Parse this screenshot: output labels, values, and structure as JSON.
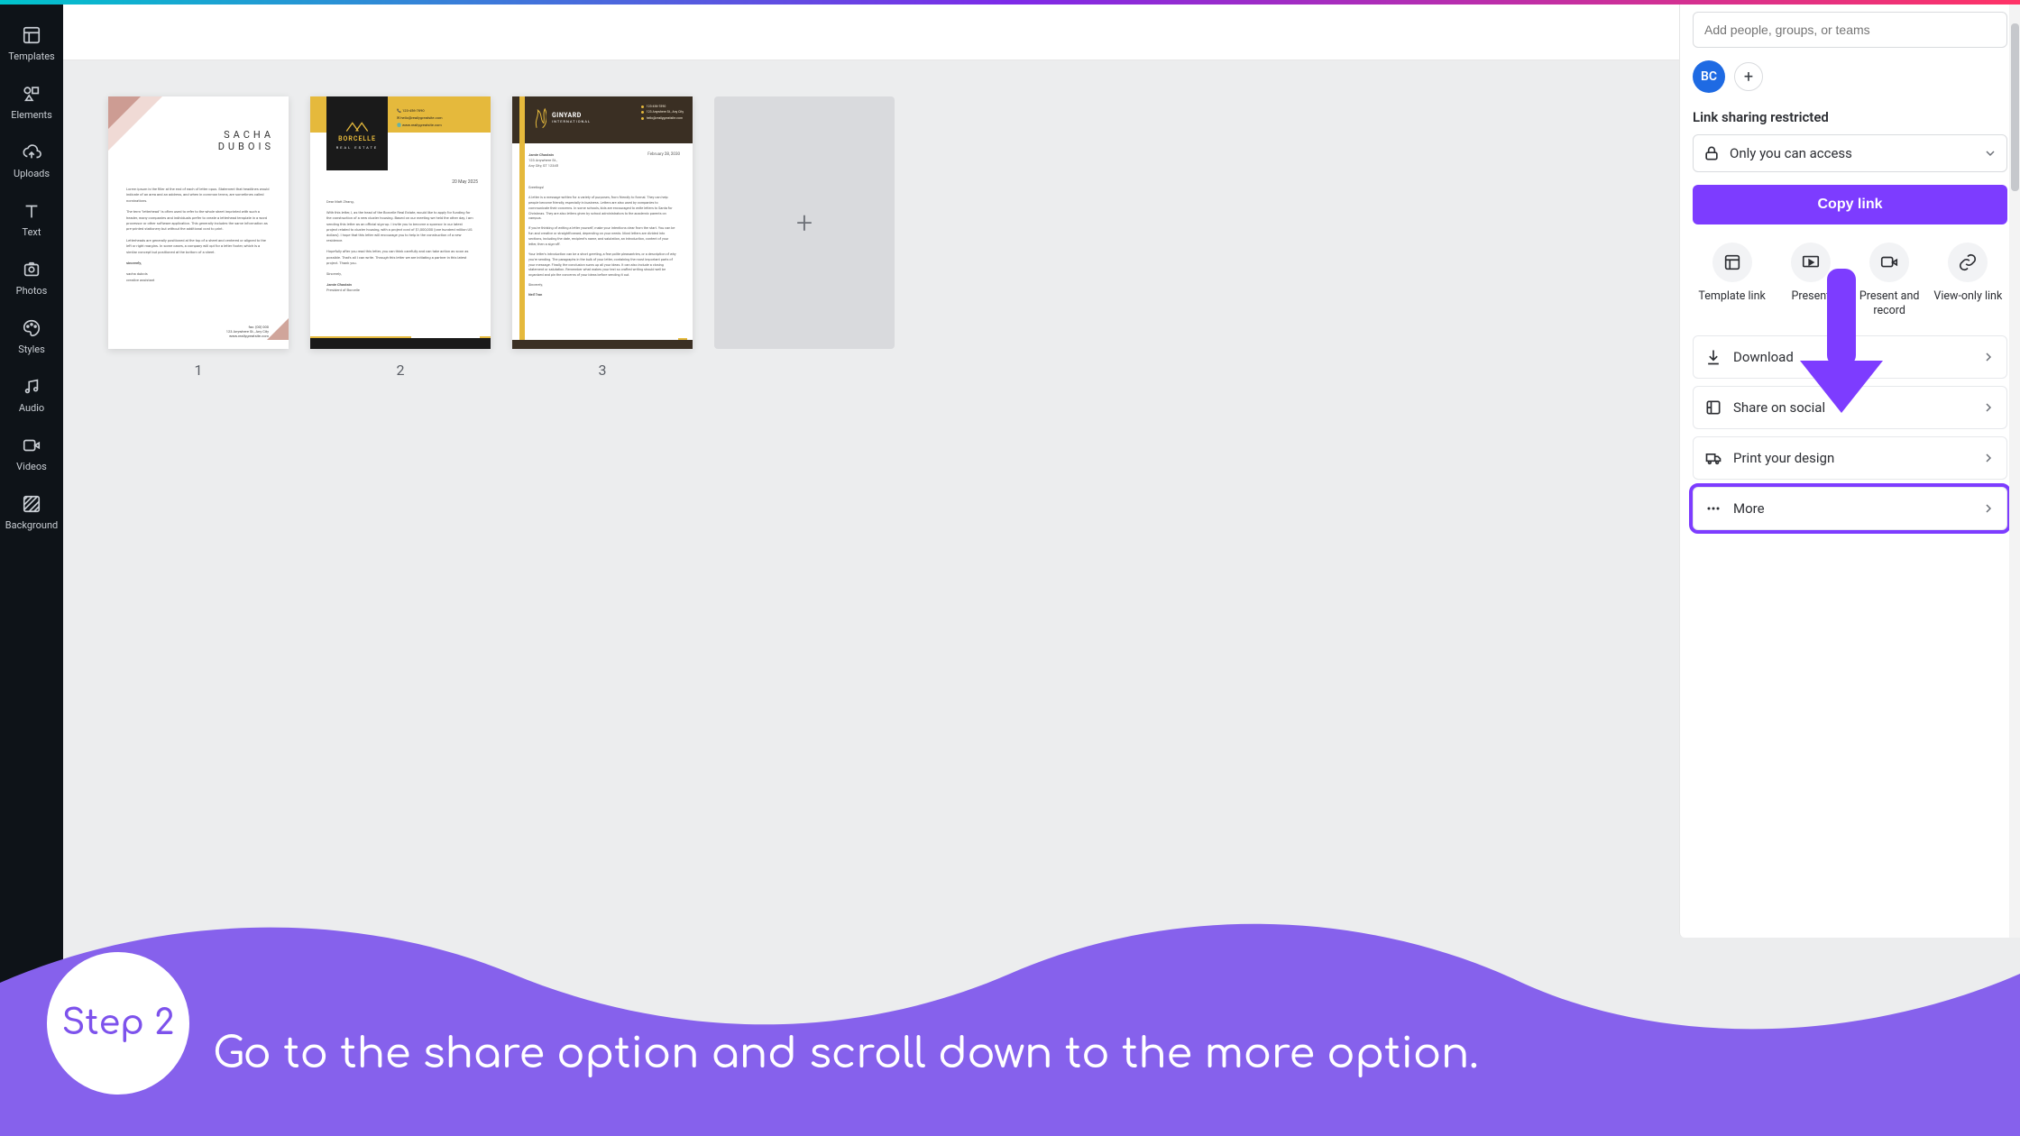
{
  "sidebar": {
    "items": [
      {
        "label": "Templates"
      },
      {
        "label": "Elements"
      },
      {
        "label": "Uploads"
      },
      {
        "label": "Text"
      },
      {
        "label": "Photos"
      },
      {
        "label": "Styles"
      },
      {
        "label": "Audio"
      },
      {
        "label": "Videos"
      },
      {
        "label": "Background"
      }
    ]
  },
  "pages": {
    "p1": {
      "num": "1",
      "name1": "SACHA",
      "name2": "DUBOIS"
    },
    "p2": {
      "num": "2",
      "brand1": "BORCELLE",
      "brand2": "REAL ESTATE",
      "c1": "123-456-7890",
      "c2": "hello@reallygreatsite.com",
      "c3": "www.reallygreatsite.com",
      "date": "20 May 2025",
      "greeting": "Dear Matt Zhang,",
      "signoff": "Sincerely,",
      "sig1": "Jamie Chastain",
      "sig2": "President of Borcelle"
    },
    "p3": {
      "num": "3",
      "brand1": "GINYARD",
      "brand2": "INTERNATIONAL",
      "i1": "123-456-7890",
      "i2": "123 Anywhere St., Any City",
      "i3": "hello@reallygreatsite.com",
      "addr_name": "Jamie Chastain",
      "addr_l1": "123 Anywhere St.,",
      "addr_l2": "Any City, ST 12345",
      "date": "February 28, 2030",
      "greeting": "Greetings!",
      "signoff": "Sincerely,",
      "sig": "Neil Tran"
    },
    "add_label": "+"
  },
  "share": {
    "input_placeholder": "Add people, groups, or teams",
    "avatar": "BC",
    "link_heading": "Link sharing restricted",
    "access_label": "Only you can access",
    "copy_label": "Copy link",
    "grid": [
      {
        "label": "Template link"
      },
      {
        "label": "Present"
      },
      {
        "label": "Present and record"
      },
      {
        "label": "View-only link"
      }
    ],
    "rows": {
      "download": "Download",
      "social": "Share on social",
      "print": "Print your design",
      "more": "More"
    }
  },
  "banner": {
    "step": "Step 2",
    "text": "Go to the share option and scroll down to the more option."
  }
}
